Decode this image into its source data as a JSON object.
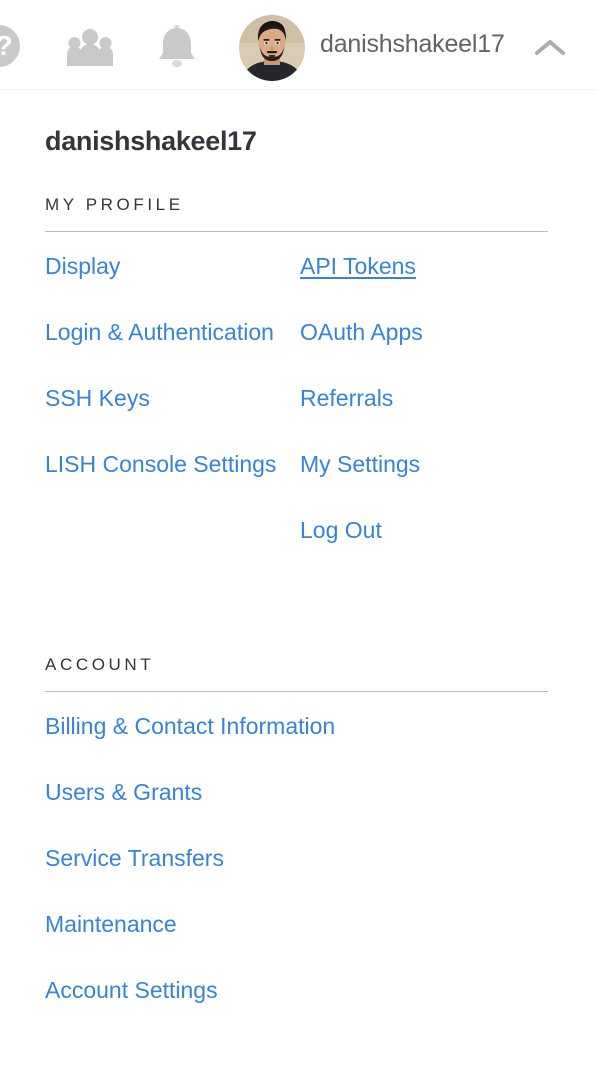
{
  "topbar": {
    "help_icon": "help-circle-icon",
    "community_icon": "people-group-icon",
    "notifications_icon": "bell-icon",
    "avatar_alt": "user-avatar",
    "username": "danishshakeel17",
    "toggle_icon": "chevron-up-icon"
  },
  "panel": {
    "profile_title": "danishshakeel17",
    "sections": [
      {
        "heading": "MY PROFILE",
        "left_links": [
          {
            "label": "Display",
            "active": false
          },
          {
            "label": "Login & Authentication",
            "active": false
          },
          {
            "label": "SSH Keys",
            "active": false
          },
          {
            "label": "LISH Console Settings",
            "active": false
          }
        ],
        "right_links": [
          {
            "label": "API Tokens",
            "active": true
          },
          {
            "label": "OAuth Apps",
            "active": false
          },
          {
            "label": "Referrals",
            "active": false
          },
          {
            "label": "My Settings",
            "active": false
          },
          {
            "label": "Log Out",
            "active": false
          }
        ]
      },
      {
        "heading": "ACCOUNT",
        "left_links": [
          {
            "label": "Billing & Contact Information",
            "active": false
          },
          {
            "label": "Users & Grants",
            "active": false
          },
          {
            "label": "Service Transfers",
            "active": false
          },
          {
            "label": "Maintenance",
            "active": false
          },
          {
            "label": "Account Settings",
            "active": false
          }
        ],
        "right_links": []
      }
    ]
  },
  "colors": {
    "link_blue": "#3683dc",
    "heading_dark": "#32363c",
    "username_gray": "#606469",
    "icon_gray": "#c9c9c9",
    "rule_gray": "#b4bac3",
    "background": "#ffffff"
  }
}
